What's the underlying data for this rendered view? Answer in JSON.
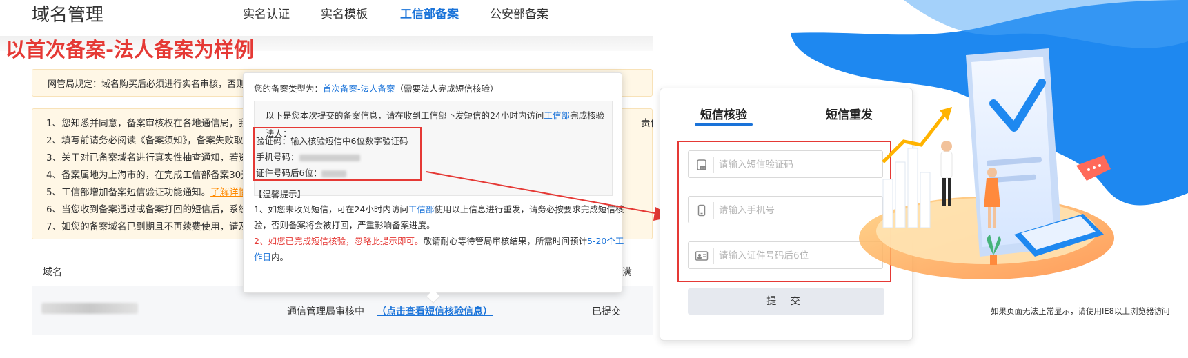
{
  "nav": {
    "title": "域名管理",
    "tabs": [
      {
        "label": "实名认证",
        "active": false
      },
      {
        "label": "实名模板",
        "active": false
      },
      {
        "label": "工信部备案",
        "active": true
      },
      {
        "label": "公安部备案",
        "active": false
      }
    ]
  },
  "annotation_label": "以首次备案-法人备案为样例",
  "notice": "网管局规定：域名购买后必须进行实名审核，否则",
  "rules": [
    {
      "text": "1、您知悉并同意，备案审核权在各地通信局，我们",
      "tail": "责任。"
    },
    {
      "text": "2、填写前请务必阅读《备案须知》，备案失败取"
    },
    {
      "text": "3、关于对已备案域名进行真实性抽查通知，若资"
    },
    {
      "text": "4、备案属地为上海市的，在完成工信部备案30天"
    },
    {
      "text": "5、工信部增加备案短信验证功能通知。",
      "link": "了解详情"
    },
    {
      "text": "6、当您收到备案通过或备案打回的短信后，系统"
    },
    {
      "text": "7、如您的备案域名已到期且不再续费使用，请及"
    }
  ],
  "table": {
    "header_domain": "域名",
    "header_right": "满",
    "row": {
      "status": "通信管理局审核中",
      "link": "（点击查看短信核验信息）",
      "submitted": "已提交"
    }
  },
  "popup": {
    "type_prefix": "您的备案类型为：",
    "type_value": "首次备案-法人备案",
    "type_suffix": "（需要法人完成短信核验）",
    "info_intro_1": "以下是您本次提交的备案信息，请在收到工信部下发短信的24小时内访问",
    "info_intro_link": "工信部",
    "info_intro_2": "完成核验",
    "legal_person": "法人：",
    "code_line": "验证码：输入核验短信中6位数字验证码",
    "phone_line": "手机号码：",
    "id_line": "证件号码后6位：",
    "tips_title": "【温馨提示】",
    "tip1_a": "1、如您未收到短信，可在24小时内访问",
    "tip1_link": "工信部",
    "tip1_b": "使用以上信息进行重发，请务必按要求完成短信核",
    "tip1_c": "验，否则备案将会被打回，严重影响备案进度。",
    "tip2_prefix": "2、",
    "tip2_red": "如您已完成短信核验，忽略此提示即可。",
    "tip2_b": "敬请耐心等待管局审核结果，所需时间预计",
    "tip2_link": "5-20个工",
    "tip2_link2": "作日",
    "tip2_end": "内。"
  },
  "form": {
    "tab_verify": "短信核验",
    "tab_resend": "短信重发",
    "code_placeholder": "请输入短信验证码",
    "phone_placeholder": "请输入手机号",
    "id_placeholder": "请输入证件号码后6位",
    "submit": "提 交"
  },
  "ie_note": "如果页面无法正常显示，请使用IE8以上浏览器访问",
  "colors": {
    "accent": "#1a73d9",
    "annotation_red": "#e53935",
    "notice_bg": "#fff7e6",
    "illus_blue": "#1e88f0"
  }
}
